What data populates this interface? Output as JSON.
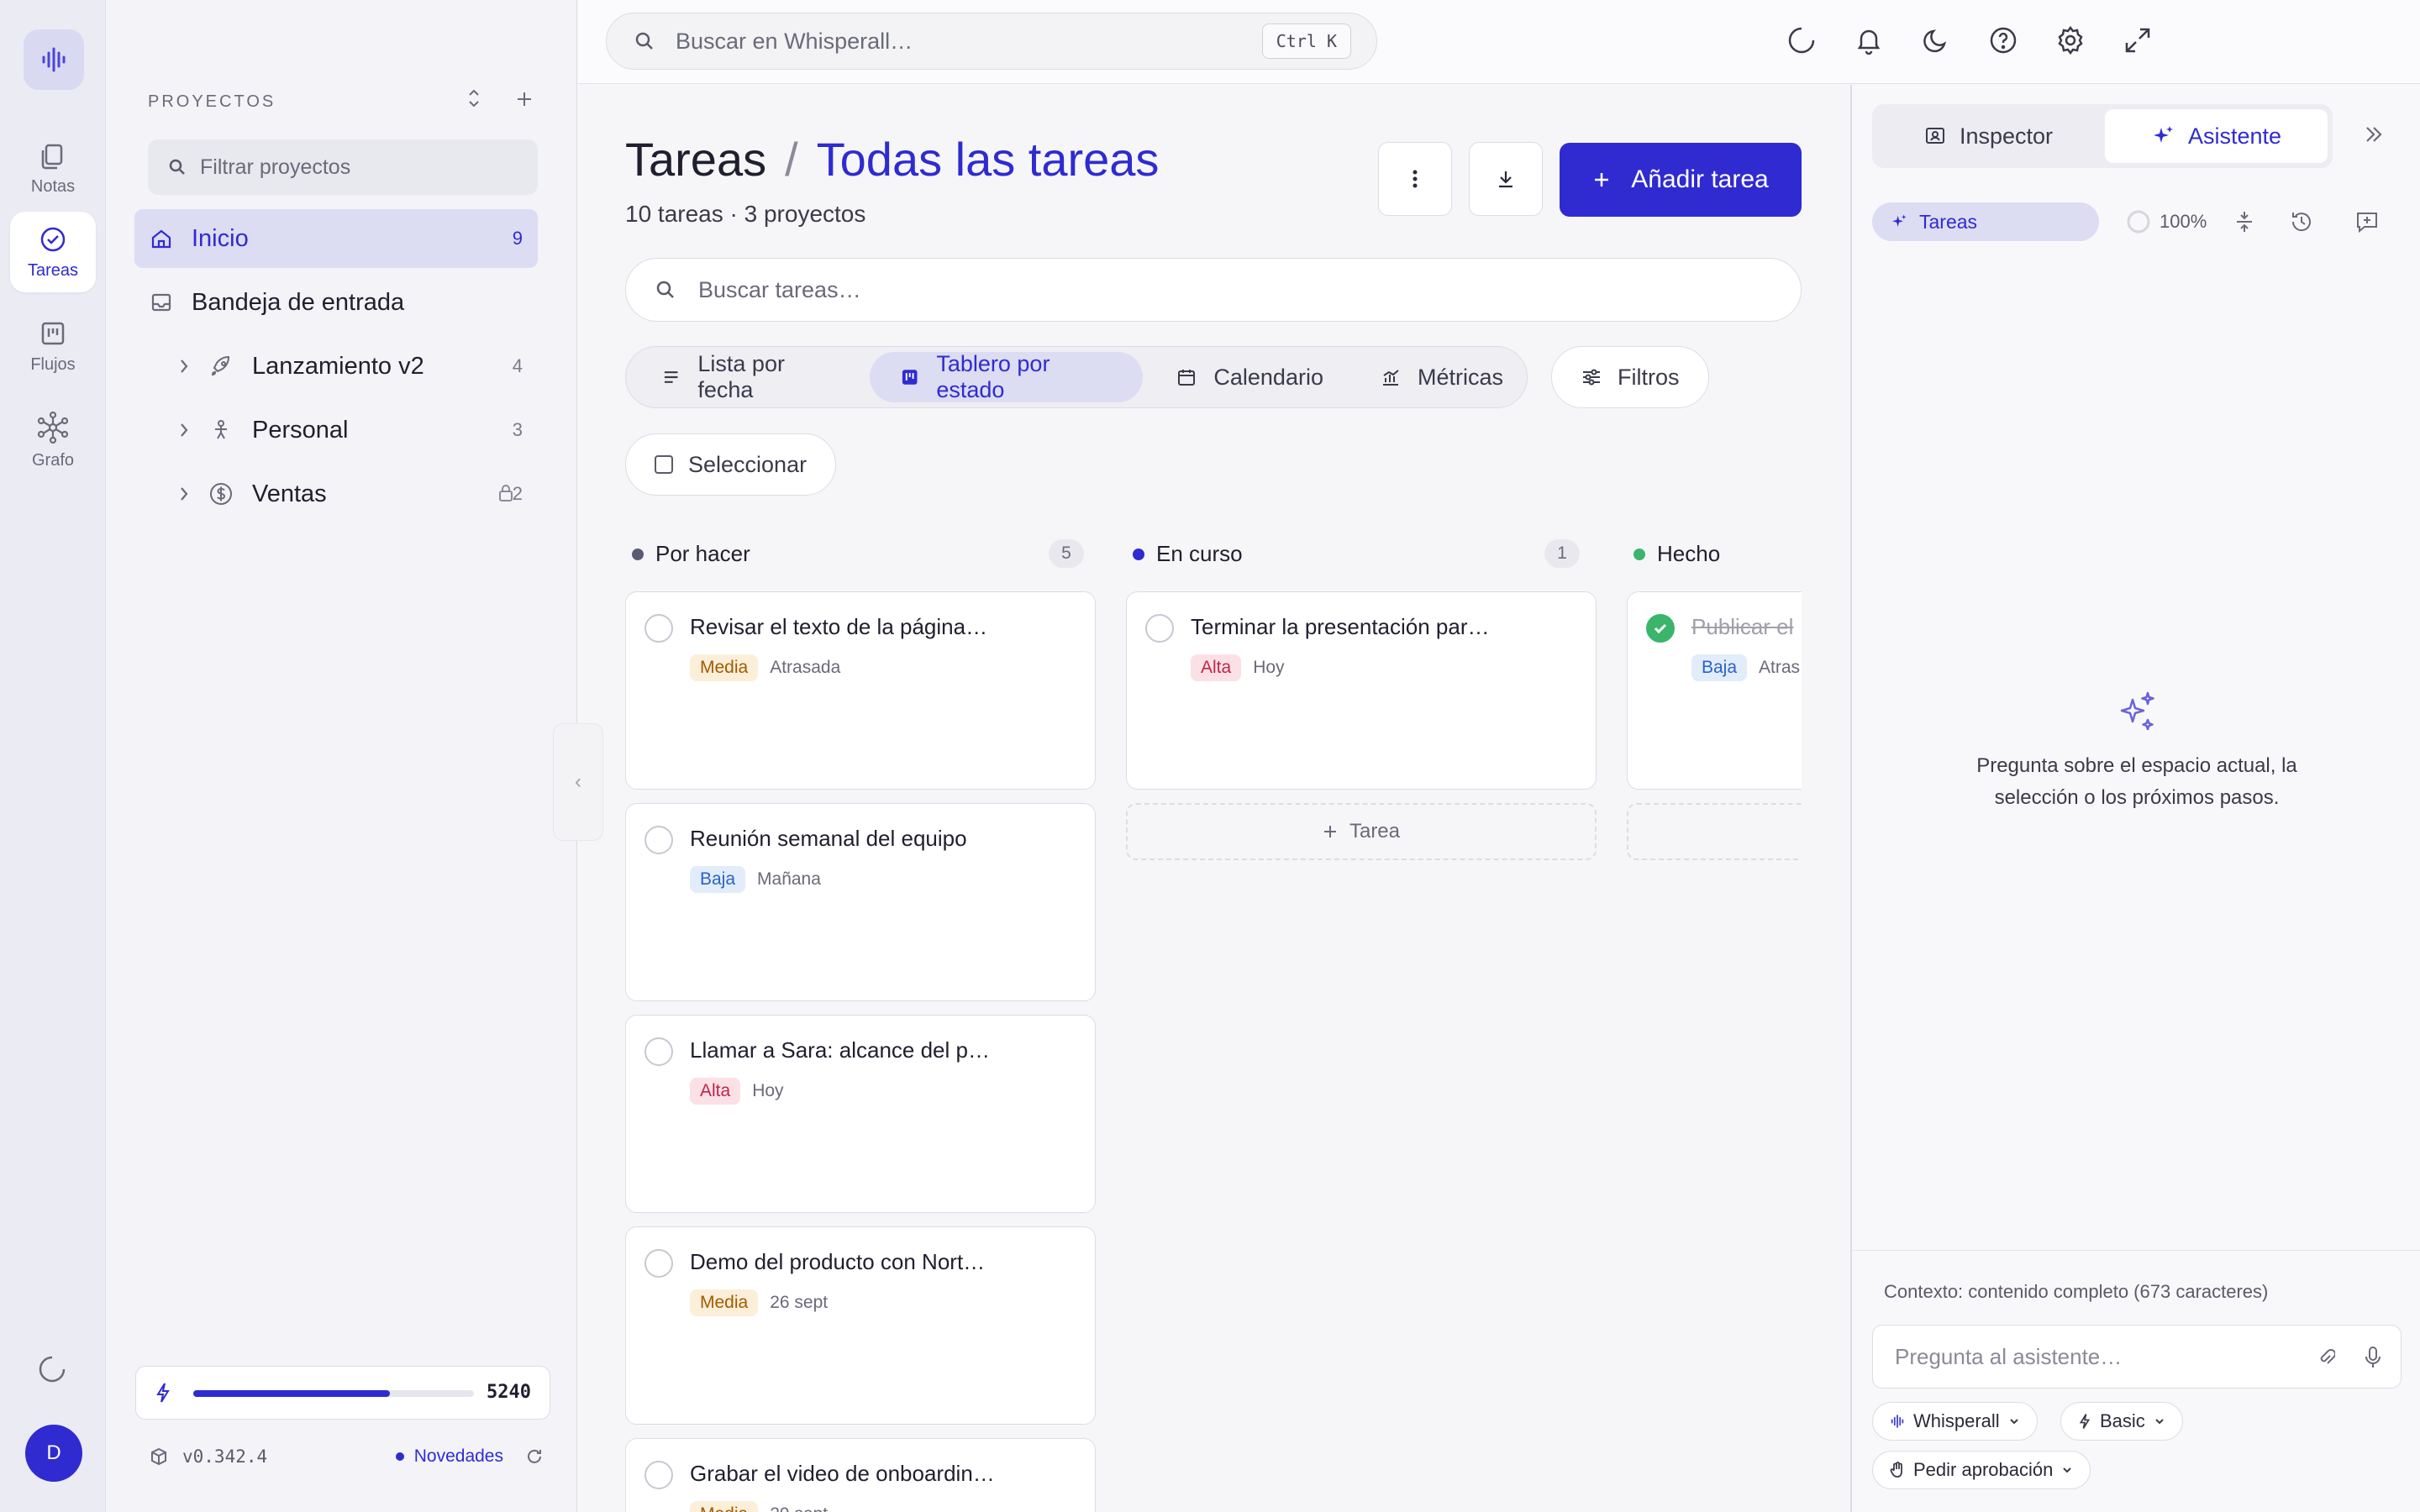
{
  "rail": {
    "items": [
      {
        "label": "Notas",
        "icon": "notes-icon"
      },
      {
        "label": "Tareas",
        "icon": "tasks-icon",
        "active": true
      },
      {
        "label": "Flujos",
        "icon": "flows-icon"
      },
      {
        "label": "Grafo",
        "icon": "graph-icon"
      }
    ],
    "avatar_initial": "D"
  },
  "sidebar": {
    "section_label": "PROYECTOS",
    "filter_placeholder": "Filtrar proyectos",
    "items": [
      {
        "label": "Inicio",
        "count": "9",
        "icon": "home-icon",
        "active": true
      },
      {
        "label": "Bandeja de entrada",
        "count": "",
        "icon": "inbox-icon"
      },
      {
        "label": "Lanzamiento v2",
        "count": "4",
        "icon": "rocket-icon"
      },
      {
        "label": "Personal",
        "count": "3",
        "icon": "person-icon"
      },
      {
        "label": "Ventas",
        "count": "2",
        "icon": "dollar-icon",
        "locked": true
      }
    ],
    "usage_value": "5240",
    "usage_fraction": 0.7,
    "version": "v0.342.4",
    "news_label": "Novedades"
  },
  "topbar": {
    "search_placeholder": "Buscar en Whisperall…",
    "shortcut": "Ctrl K"
  },
  "main": {
    "title": "Tareas",
    "title_separator": "/",
    "title_sub": "Todas las tareas",
    "subtitle": "10 tareas · 3 proyectos",
    "add_button": "Añadir tarea",
    "task_search_placeholder": "Buscar tareas…",
    "views": [
      {
        "label": "Lista por fecha",
        "icon": "list-icon"
      },
      {
        "label": "Tablero por estado",
        "icon": "board-icon",
        "active": true
      },
      {
        "label": "Calendario",
        "icon": "calendar-icon"
      },
      {
        "label": "Métricas",
        "icon": "chart-icon"
      }
    ],
    "filters_label": "Filtros",
    "select_label": "Seleccionar",
    "add_task_inline": "Tarea"
  },
  "board": {
    "columns": [
      {
        "name": "Por hacer",
        "count": "5",
        "color": "#5a5a72",
        "cards": [
          {
            "title": "Revisar el texto de la página…",
            "priority": "Media",
            "date": "Atrasada"
          },
          {
            "title": "Reunión semanal del equipo",
            "priority": "Baja",
            "date": "Mañana"
          },
          {
            "title": "Llamar a Sara: alcance del p…",
            "priority": "Alta",
            "date": "Hoy"
          },
          {
            "title": "Demo del producto con Nort…",
            "priority": "Media",
            "date": "26 sept"
          },
          {
            "title": "Grabar el video de onboardin…",
            "priority": "Media",
            "date": "29 sept"
          }
        ]
      },
      {
        "name": "En curso",
        "count": "1",
        "color": "#2f2bd1",
        "cards": [
          {
            "title": "Terminar la presentación par…",
            "priority": "Alta",
            "date": "Hoy"
          }
        ]
      },
      {
        "name": "Hecho",
        "count": "",
        "color": "#3bb56b",
        "cards": [
          {
            "title": "Publicar el",
            "priority": "Baja",
            "date": "Atras",
            "done": true
          }
        ]
      }
    ]
  },
  "assistant": {
    "tabs": [
      {
        "label": "Inspector",
        "icon": "inspector-icon"
      },
      {
        "label": "Asistente",
        "icon": "sparkle-icon",
        "active": true
      }
    ],
    "context_chip": "Tareas",
    "progress": "100%",
    "empty_text": "Pregunta sobre el espacio actual, la selección o los próximos pasos.",
    "context_note": "Contexto: contenido completo (673 caracteres)",
    "input_placeholder": "Pregunta al asistente…",
    "chips": [
      "Whisperall",
      "Basic",
      "Pedir aprobación"
    ]
  }
}
